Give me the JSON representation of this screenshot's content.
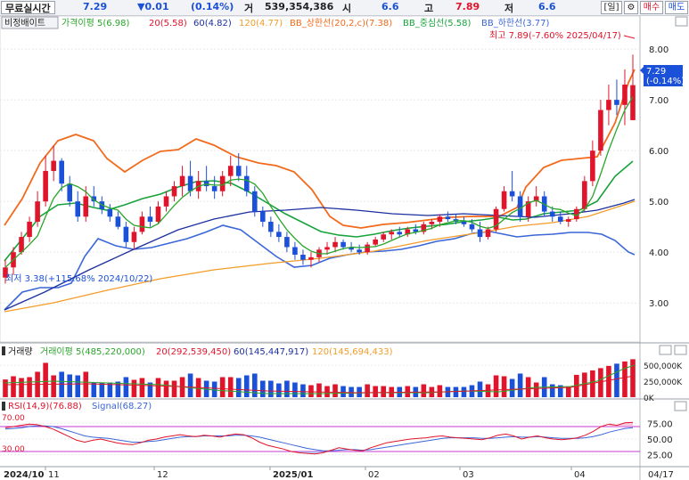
{
  "header": {
    "title": "무료실시간",
    "price": "7.29",
    "change": "▼0.01",
    "change_pct": "(0.14%)",
    "volume_label": "거",
    "volume": "539,354,386",
    "open_label": "시",
    "open": "6.6",
    "high_label": "고",
    "high": "7.89",
    "low_label": "저",
    "low": "6.6",
    "period_btn": "[일]",
    "settings_btn": "⚙",
    "buy_btn": "매수",
    "sell_btn": "매도",
    "colors": {
      "up": "#e0142b",
      "down": "#1b50d8"
    }
  },
  "main_legend": {
    "chart_btn": "비정배이트",
    "items": [
      {
        "label": "가격이평 5(6.98)",
        "color": "#2aa52a"
      },
      {
        "label": "20(5.58)",
        "color": "#e0142b"
      },
      {
        "label": "60(4.82)",
        "color": "#1c2fa0"
      },
      {
        "label": "120(4.77)",
        "color": "#f39c2a"
      },
      {
        "label": "BB_상한선(20,2,c)(7.38)",
        "color": "#f26a1b"
      },
      {
        "label": "BB_중심선(5.58)",
        "color": "#17a23b"
      },
      {
        "label": "BB_하한선(3.77)",
        "color": "#3a66d8"
      }
    ]
  },
  "annotations": {
    "high": "최고 7.89(-7.60% 2025/04/17)",
    "low": "최저 3.38(+115.68% 2024/10/22)",
    "last_price": "7.29",
    "last_change": "(-0.14%)"
  },
  "price_axis": {
    "ticks": [
      "8.00",
      "7.00",
      "6.00",
      "5.00",
      "4.00",
      "3.00"
    ],
    "values": [
      8,
      7,
      6,
      5,
      4,
      3
    ]
  },
  "volume_legend": {
    "title": "거래량",
    "items": [
      {
        "label": "거래이평 5(485,220,000)",
        "color": "#2aa52a"
      },
      {
        "label": "20(292,539,450)",
        "color": "#e0142b"
      },
      {
        "label": "60(145,447,917)",
        "color": "#1c2fa0"
      },
      {
        "label": "120(145,694,433)",
        "color": "#f39c2a"
      }
    ]
  },
  "volume_axis": {
    "ticks": [
      "500,000K",
      "250,000K",
      "0K"
    ]
  },
  "rsi_legend": {
    "items": [
      {
        "label": "RSI(14,9)(76.88)",
        "color": "#e0142b"
      },
      {
        "label": "Signal(68.27)",
        "color": "#3a66d8"
      }
    ],
    "level_hi": "70.00",
    "level_lo": "30.00"
  },
  "rsi_axis": {
    "ticks": [
      "75.00",
      "50.00",
      "25.00"
    ]
  },
  "x_axis": {
    "labels": [
      "2024/10",
      "11",
      "12",
      "2025/01",
      "02",
      "03",
      "04",
      "04/17"
    ]
  },
  "chart_data": {
    "type": "candlestick",
    "price_ylim": [
      2.6,
      8.3
    ],
    "candles": [
      {
        "o": 3.5,
        "h": 3.85,
        "l": 3.38,
        "c": 3.7
      },
      {
        "o": 3.7,
        "h": 4.1,
        "l": 3.55,
        "c": 4.0
      },
      {
        "o": 4.0,
        "h": 4.4,
        "l": 3.95,
        "c": 4.3
      },
      {
        "o": 4.3,
        "h": 4.7,
        "l": 4.2,
        "c": 4.6
      },
      {
        "o": 4.6,
        "h": 5.2,
        "l": 4.5,
        "c": 5.0
      },
      {
        "o": 5.0,
        "h": 5.9,
        "l": 4.9,
        "c": 5.6
      },
      {
        "o": 5.6,
        "h": 6.1,
        "l": 5.4,
        "c": 5.8
      },
      {
        "o": 5.8,
        "h": 5.85,
        "l": 5.2,
        "c": 5.35
      },
      {
        "o": 5.35,
        "h": 5.5,
        "l": 4.9,
        "c": 5.0
      },
      {
        "o": 5.0,
        "h": 5.2,
        "l": 4.6,
        "c": 4.7
      },
      {
        "o": 4.7,
        "h": 5.3,
        "l": 4.6,
        "c": 5.1
      },
      {
        "o": 5.1,
        "h": 5.3,
        "l": 4.9,
        "c": 5.0
      },
      {
        "o": 5.0,
        "h": 5.1,
        "l": 4.75,
        "c": 4.85
      },
      {
        "o": 4.85,
        "h": 4.95,
        "l": 4.6,
        "c": 4.7
      },
      {
        "o": 4.7,
        "h": 4.8,
        "l": 4.45,
        "c": 4.5
      },
      {
        "o": 4.5,
        "h": 4.6,
        "l": 4.1,
        "c": 4.2
      },
      {
        "o": 4.2,
        "h": 4.5,
        "l": 4.05,
        "c": 4.4
      },
      {
        "o": 4.4,
        "h": 4.8,
        "l": 4.35,
        "c": 4.7
      },
      {
        "o": 4.7,
        "h": 4.9,
        "l": 4.5,
        "c": 4.6
      },
      {
        "o": 4.6,
        "h": 5.0,
        "l": 4.55,
        "c": 4.9
      },
      {
        "o": 4.9,
        "h": 5.2,
        "l": 4.8,
        "c": 5.1
      },
      {
        "o": 5.1,
        "h": 5.4,
        "l": 5.0,
        "c": 5.3
      },
      {
        "o": 5.3,
        "h": 5.7,
        "l": 5.1,
        "c": 5.5
      },
      {
        "o": 5.5,
        "h": 5.8,
        "l": 5.1,
        "c": 5.2
      },
      {
        "o": 5.2,
        "h": 5.6,
        "l": 5.05,
        "c": 5.4
      },
      {
        "o": 5.4,
        "h": 5.7,
        "l": 5.2,
        "c": 5.3
      },
      {
        "o": 5.3,
        "h": 5.5,
        "l": 5.05,
        "c": 5.2
      },
      {
        "o": 5.2,
        "h": 5.6,
        "l": 5.1,
        "c": 5.5
      },
      {
        "o": 5.5,
        "h": 5.9,
        "l": 5.3,
        "c": 5.7
      },
      {
        "o": 5.7,
        "h": 5.95,
        "l": 5.4,
        "c": 5.5
      },
      {
        "o": 5.5,
        "h": 5.7,
        "l": 5.1,
        "c": 5.2
      },
      {
        "o": 5.2,
        "h": 5.3,
        "l": 4.7,
        "c": 4.8
      },
      {
        "o": 4.8,
        "h": 4.9,
        "l": 4.5,
        "c": 4.6
      },
      {
        "o": 4.6,
        "h": 4.7,
        "l": 4.3,
        "c": 4.4
      },
      {
        "o": 4.4,
        "h": 4.55,
        "l": 4.2,
        "c": 4.3
      },
      {
        "o": 4.3,
        "h": 4.4,
        "l": 4.0,
        "c": 4.1
      },
      {
        "o": 4.1,
        "h": 4.2,
        "l": 3.85,
        "c": 3.95
      },
      {
        "o": 3.95,
        "h": 4.05,
        "l": 3.75,
        "c": 3.85
      },
      {
        "o": 3.85,
        "h": 4.0,
        "l": 3.7,
        "c": 3.9
      },
      {
        "o": 3.9,
        "h": 4.1,
        "l": 3.8,
        "c": 4.05
      },
      {
        "o": 4.05,
        "h": 4.2,
        "l": 3.95,
        "c": 4.1
      },
      {
        "o": 4.1,
        "h": 4.3,
        "l": 4.0,
        "c": 4.2
      },
      {
        "o": 4.2,
        "h": 4.25,
        "l": 4.05,
        "c": 4.1
      },
      {
        "o": 4.1,
        "h": 4.2,
        "l": 4.0,
        "c": 4.05
      },
      {
        "o": 4.05,
        "h": 4.15,
        "l": 3.95,
        "c": 4.0
      },
      {
        "o": 4.0,
        "h": 4.2,
        "l": 3.95,
        "c": 4.15
      },
      {
        "o": 4.15,
        "h": 4.3,
        "l": 4.1,
        "c": 4.25
      },
      {
        "o": 4.25,
        "h": 4.4,
        "l": 4.2,
        "c": 4.35
      },
      {
        "o": 4.35,
        "h": 4.45,
        "l": 4.25,
        "c": 4.4
      },
      {
        "o": 4.4,
        "h": 4.5,
        "l": 4.3,
        "c": 4.35
      },
      {
        "o": 4.35,
        "h": 4.5,
        "l": 4.3,
        "c": 4.45
      },
      {
        "o": 4.45,
        "h": 4.55,
        "l": 4.35,
        "c": 4.4
      },
      {
        "o": 4.4,
        "h": 4.6,
        "l": 4.35,
        "c": 4.55
      },
      {
        "o": 4.55,
        "h": 4.65,
        "l": 4.45,
        "c": 4.6
      },
      {
        "o": 4.6,
        "h": 4.75,
        "l": 4.5,
        "c": 4.7
      },
      {
        "o": 4.7,
        "h": 4.8,
        "l": 4.6,
        "c": 4.65
      },
      {
        "o": 4.65,
        "h": 4.75,
        "l": 4.55,
        "c": 4.6
      },
      {
        "o": 4.6,
        "h": 4.7,
        "l": 4.5,
        "c": 4.55
      },
      {
        "o": 4.55,
        "h": 4.65,
        "l": 4.4,
        "c": 4.45
      },
      {
        "o": 4.45,
        "h": 4.6,
        "l": 4.2,
        "c": 4.3
      },
      {
        "o": 4.3,
        "h": 4.5,
        "l": 4.25,
        "c": 4.45
      },
      {
        "o": 4.45,
        "h": 4.9,
        "l": 4.4,
        "c": 4.85
      },
      {
        "o": 4.85,
        "h": 5.3,
        "l": 4.8,
        "c": 5.2
      },
      {
        "o": 5.2,
        "h": 5.6,
        "l": 5.0,
        "c": 5.1
      },
      {
        "o": 5.1,
        "h": 5.2,
        "l": 4.6,
        "c": 4.7
      },
      {
        "o": 4.7,
        "h": 5.1,
        "l": 4.6,
        "c": 5.0
      },
      {
        "o": 5.0,
        "h": 5.3,
        "l": 4.9,
        "c": 5.1
      },
      {
        "o": 5.1,
        "h": 5.2,
        "l": 4.7,
        "c": 4.8
      },
      {
        "o": 4.8,
        "h": 4.9,
        "l": 4.6,
        "c": 4.7
      },
      {
        "o": 4.7,
        "h": 4.8,
        "l": 4.55,
        "c": 4.6
      },
      {
        "o": 4.6,
        "h": 4.7,
        "l": 4.5,
        "c": 4.65
      },
      {
        "o": 4.65,
        "h": 4.9,
        "l": 4.6,
        "c": 4.85
      },
      {
        "o": 4.85,
        "h": 5.5,
        "l": 4.8,
        "c": 5.4
      },
      {
        "o": 5.4,
        "h": 6.2,
        "l": 5.3,
        "c": 6.0
      },
      {
        "o": 6.0,
        "h": 7.0,
        "l": 5.9,
        "c": 6.8
      },
      {
        "o": 6.8,
        "h": 7.3,
        "l": 6.5,
        "c": 7.0
      },
      {
        "o": 7.0,
        "h": 7.4,
        "l": 6.7,
        "c": 6.9
      },
      {
        "o": 6.9,
        "h": 7.6,
        "l": 6.5,
        "c": 7.3
      },
      {
        "o": 6.6,
        "h": 7.89,
        "l": 6.6,
        "c": 7.29
      }
    ],
    "volume_max": 600000,
    "volume_units": "K",
    "rsi_ylim": [
      10,
      90
    ],
    "rsi": [
      68,
      70,
      72,
      74,
      73,
      70,
      66,
      60,
      54,
      48,
      45,
      48,
      50,
      47,
      44,
      42,
      41,
      44,
      48,
      50,
      53,
      55,
      57,
      55,
      54,
      56,
      55,
      53,
      56,
      58,
      57,
      52,
      45,
      40,
      37,
      34,
      30,
      28,
      27,
      26,
      28,
      32,
      36,
      34,
      32,
      31,
      36,
      40,
      44,
      46,
      48,
      50,
      51,
      52,
      54,
      55,
      53,
      52,
      51,
      50,
      49,
      52,
      56,
      58,
      55,
      50,
      53,
      55,
      52,
      50,
      49,
      50,
      52,
      56,
      62,
      70,
      74,
      72,
      76,
      76.88
    ],
    "signal": [
      66,
      67,
      68,
      70,
      71,
      71,
      70,
      67,
      63,
      59,
      55,
      53,
      52,
      51,
      49,
      47,
      45,
      45,
      46,
      47,
      49,
      51,
      53,
      54,
      54,
      55,
      55,
      55,
      55,
      56,
      56,
      55,
      53,
      50,
      47,
      44,
      41,
      38,
      35,
      33,
      31,
      31,
      32,
      33,
      33,
      32,
      33,
      35,
      37,
      39,
      41,
      43,
      45,
      47,
      49,
      51,
      52,
      52,
      52,
      52,
      51,
      51,
      52,
      53,
      54,
      53,
      53,
      54,
      53,
      52,
      51,
      51,
      51,
      52,
      54,
      57,
      61,
      64,
      67,
      68.27
    ]
  }
}
